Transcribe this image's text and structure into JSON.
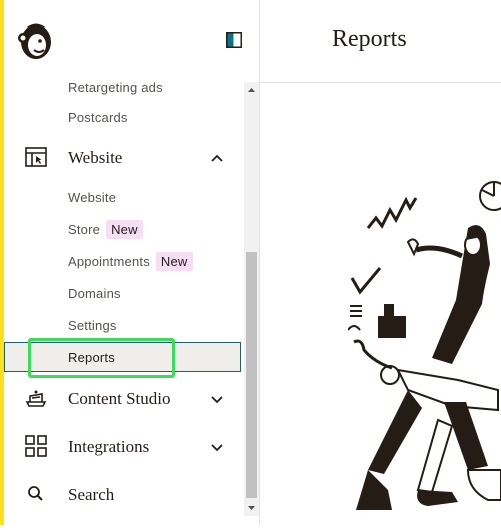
{
  "page": {
    "title": "Reports"
  },
  "sidebar": {
    "logo_icon": "mailchimp-freddie-logo",
    "collapse_icon": "panel-toggle-icon",
    "sub_items_top": [
      {
        "label": "Retargeting ads"
      },
      {
        "label": "Postcards"
      }
    ],
    "website_section": {
      "label": "Website",
      "icon": "website-icon",
      "expanded": true
    },
    "website_items": [
      {
        "label": "Website"
      },
      {
        "label": "Store",
        "badge": "New"
      },
      {
        "label": "Appointments",
        "badge": "New"
      },
      {
        "label": "Domains"
      },
      {
        "label": "Settings"
      },
      {
        "label": "Reports",
        "selected": true
      }
    ],
    "sections": [
      {
        "label": "Content Studio",
        "icon": "content-studio-icon"
      },
      {
        "label": "Integrations",
        "icon": "integrations-grid-icon"
      },
      {
        "label": "Search",
        "icon": "search-icon"
      }
    ]
  },
  "colors": {
    "accent": "#ffe01b",
    "badge_bg": "#f6dff5",
    "highlight": "#3ddc57",
    "selected_border": "#1e5e73"
  }
}
